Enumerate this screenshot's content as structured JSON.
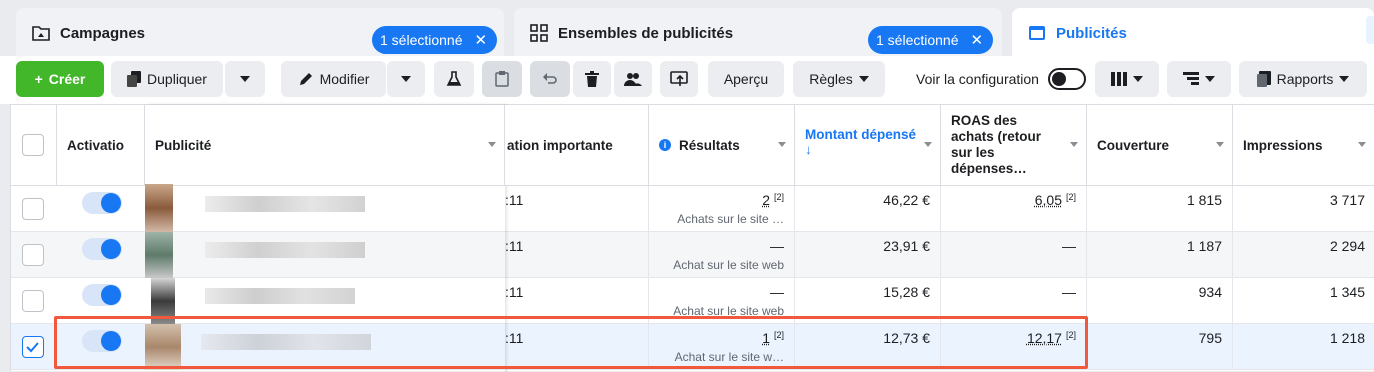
{
  "tabs": {
    "campaigns": {
      "label": "Campagnes",
      "selection": "1 sélectionné"
    },
    "adsets": {
      "label": "Ensembles de publicités",
      "selection": "1 sélectionné"
    },
    "ads": {
      "label": "Publicités"
    }
  },
  "toolbar": {
    "create": "Créer",
    "duplicate": "Dupliquer",
    "edit": "Modifier",
    "preview": "Aperçu",
    "rules": "Règles",
    "view_setup": "Voir la configuration",
    "reports": "Rapports"
  },
  "table": {
    "headers": {
      "activation": "Activatio",
      "ad": "Publicité",
      "attribution": "ation importante",
      "results": "Résultats",
      "spend": "Montant dépensé",
      "spend_arrow": "↓",
      "roas": "ROAS des achats (retour sur les dépenses…",
      "reach": "Couverture",
      "impressions": "Impressions"
    },
    "rows": [
      {
        "time": ":11",
        "result": "2",
        "result_sup": "[2]",
        "result_sub": "Achats sur le site …",
        "spend": "46,22 €",
        "roas": "6,05",
        "roas_sup": "[2]",
        "reach": "1 815",
        "impressions": "3 717"
      },
      {
        "time": ":11",
        "result": "—",
        "result_sub": "Achat sur le site web",
        "spend": "23,91 €",
        "roas": "—",
        "reach": "1 187",
        "impressions": "2 294"
      },
      {
        "time": ":11",
        "result": "—",
        "result_sub": "Achat sur le site web",
        "spend": "15,28 €",
        "roas": "—",
        "reach": "934",
        "impressions": "1 345"
      },
      {
        "time": ":11",
        "result": "1",
        "result_sup": "[2]",
        "result_sub": "Achat sur le site w…",
        "spend": "12,73 €",
        "roas": "12,17",
        "roas_sup": "[2]",
        "reach": "795",
        "impressions": "1 218"
      }
    ]
  },
  "colors": {
    "accent": "#1877f2",
    "create": "#42b72a",
    "highlight": "#f0593e"
  }
}
